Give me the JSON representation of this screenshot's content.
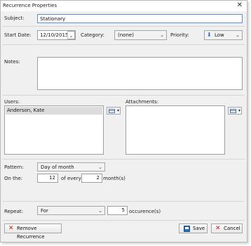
{
  "window": {
    "title": "Recurrence Properties"
  },
  "subject": {
    "label": "Subject:",
    "value": "Stationary"
  },
  "start_date": {
    "label": "Start Date:",
    "value": "12/10/2015"
  },
  "category": {
    "label": "Category:",
    "value": "(none)"
  },
  "priority": {
    "label": "Priority:",
    "value": "Low"
  },
  "notes": {
    "label": "Notes:"
  },
  "users": {
    "label": "Users:",
    "items": [
      "Anderson, Kate"
    ]
  },
  "attachments": {
    "label": "Attachments:"
  },
  "pattern": {
    "label": "Pattern:",
    "value": "Day of month"
  },
  "on_the": {
    "label": "On the:",
    "day": "12",
    "of_every_label": "of every",
    "months": "2",
    "months_suffix": "month(s)"
  },
  "repeat": {
    "label": "Repeat:",
    "mode": "For",
    "count": "5",
    "suffix": "occurence(s)"
  },
  "buttons": {
    "remove": "Remove Recurrence",
    "save": "Save",
    "cancel": "Cancel"
  }
}
